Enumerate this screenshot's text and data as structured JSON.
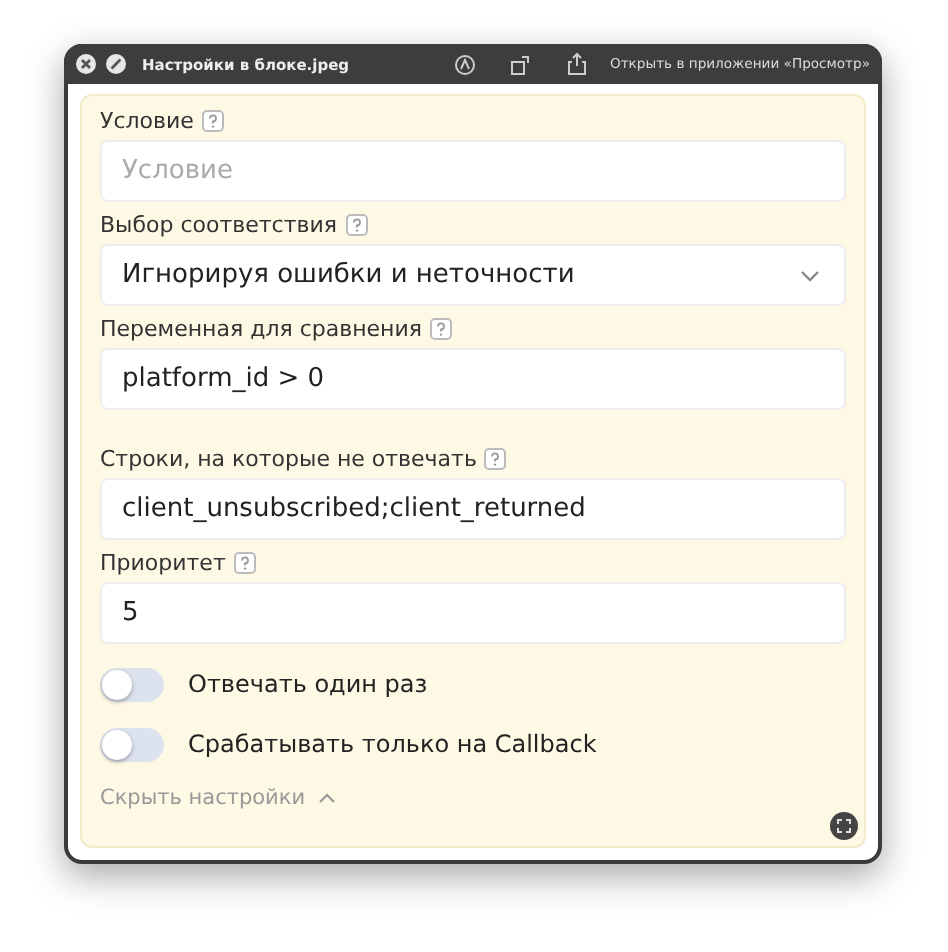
{
  "window": {
    "title": "Настройки в блоке.jpeg",
    "open_with": "Открыть в приложении «Просмотр»"
  },
  "fields": [
    {
      "kind": "text",
      "label": "Условие",
      "placeholder": "Условие"
    },
    {
      "kind": "select",
      "label": "Выбор соответствия",
      "value": "Игнорируя ошибки и неточности"
    },
    {
      "kind": "text",
      "label": "Переменная для сравнения",
      "value": "platform_id > 0"
    },
    {
      "kind": "text",
      "label": "Строки, на которые не отвечать",
      "value": "client_unsubscribed;client_returned"
    },
    {
      "kind": "text",
      "label": "Приоритет",
      "value": "5"
    }
  ],
  "toggles": [
    {
      "label": "Отвечать один раз",
      "on": false
    },
    {
      "label": "Срабатывать только на Callback",
      "on": false
    }
  ],
  "hide_link": "Скрыть настройки"
}
